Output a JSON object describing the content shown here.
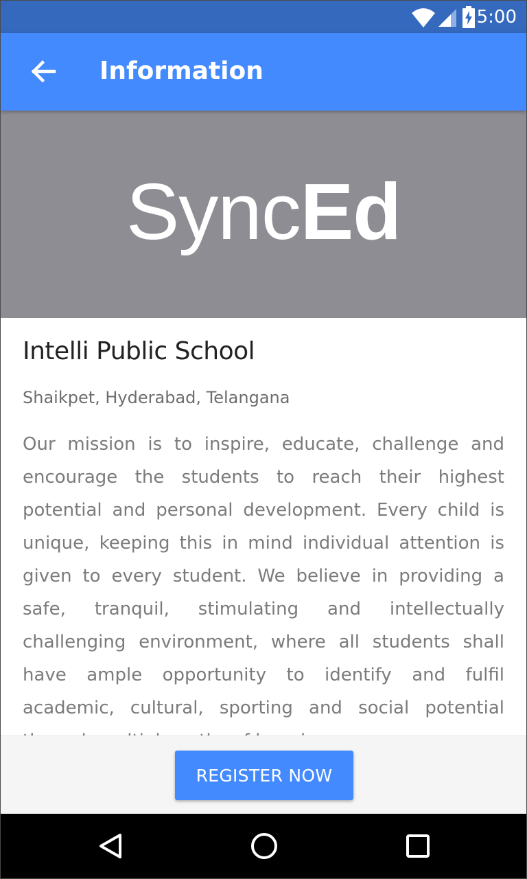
{
  "status_bar": {
    "time": "5:00",
    "icons": [
      "wifi-icon",
      "signal-icon",
      "battery-charging-icon"
    ]
  },
  "app_bar": {
    "title": "Information",
    "back_icon": "arrow-back-icon"
  },
  "banner": {
    "logo_light": "Sync",
    "logo_bold": "Ed",
    "background_color": "#8e8d93"
  },
  "school": {
    "name": "Intelli Public School",
    "location": "Shaikpet, Hyderabad, Telangana",
    "description": "Our mission is to inspire, educate, challenge and encourage the students to reach their highest potential and personal development. Every child is unique, keeping this in mind individual attention is given to every student.  We believe in providing a safe, tranquil, stimulating and intellectually challenging environment,  where all students shall have ample opportunity to identify and fulfil academic, cultural, sporting and social potential through multiple paths of learning."
  },
  "actions": {
    "register_label": "REGISTER NOW"
  },
  "nav_bar": {
    "icons": [
      "nav-back-icon",
      "nav-home-icon",
      "nav-recents-icon"
    ]
  },
  "colors": {
    "status_bar": "#3569bd",
    "app_bar": "#448aff",
    "accent": "#448aff"
  }
}
